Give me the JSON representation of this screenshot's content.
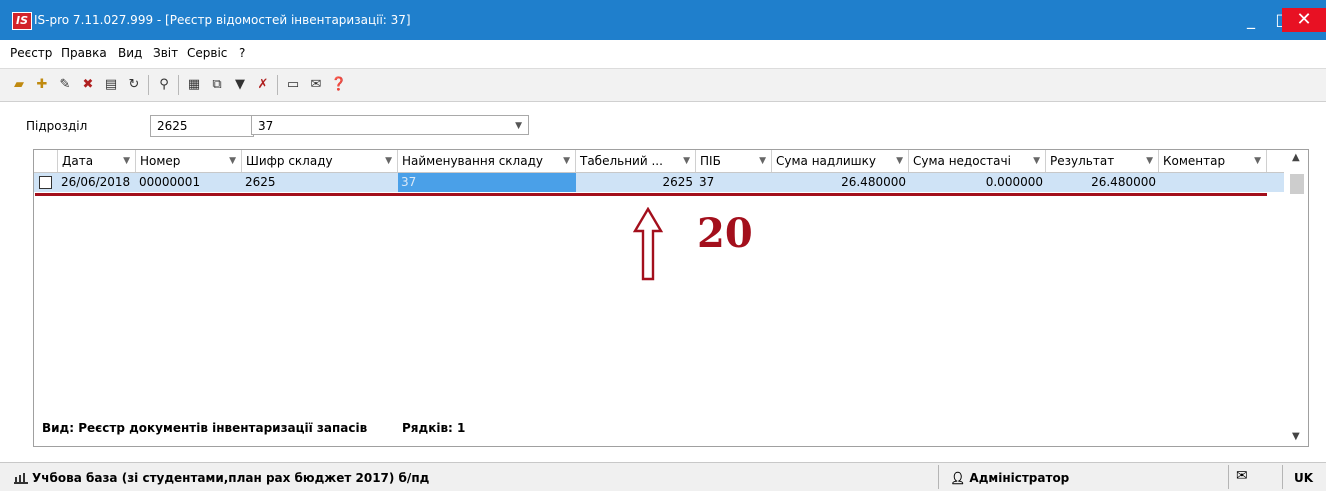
{
  "window": {
    "logo_text": "IS",
    "title": "IS-pro 7.11.027.999 - [Реєстр відомостей інвентаризації: 37]",
    "minimize_glyph": "_",
    "maximize_glyph": "□",
    "close_glyph": "✕"
  },
  "menu": {
    "items": [
      "Реєстр",
      "Правка",
      "Вид",
      "Звіт",
      "Сервіс",
      "?"
    ]
  },
  "toolbar": {
    "icons": [
      "open-folder-icon",
      "new-document-icon",
      "edit-document-icon",
      "delete-document-icon",
      "print-icon",
      "refresh-icon",
      "search-icon",
      "grid-view-icon",
      "copy-icon",
      "filter-icon",
      "clear-filter-icon",
      "form-icon",
      "mail-icon",
      "help-icon"
    ]
  },
  "filter": {
    "label": "Підрозділ",
    "code": "2625",
    "name": "37"
  },
  "grid": {
    "columns": [
      "Дата",
      "Номер",
      "Шифр складу",
      "Найменування складу",
      "Табельний ...",
      "ПІБ",
      "Сума надлишку",
      "Сума недостачі",
      "Результат",
      "Коментар"
    ],
    "rows": [
      {
        "date": "26/06/2018",
        "number": "00000001",
        "warehouse_code": "2625",
        "warehouse_name": "37",
        "tab_number": "2625",
        "full_name": "37",
        "surplus": "26.480000",
        "shortage": "0.000000",
        "result": "26.480000",
        "comment": ""
      }
    ],
    "footer_view": "Вид: Реєстр документів інвентаризації запасів",
    "footer_rows": "Рядків: 1"
  },
  "annotation": {
    "number": "20",
    "color": "#a30f1c"
  },
  "status": {
    "database": "Учбова база (зі студентами,план рах бюджет 2017) б/пд",
    "user": "Адміністратор",
    "language": "UK"
  }
}
